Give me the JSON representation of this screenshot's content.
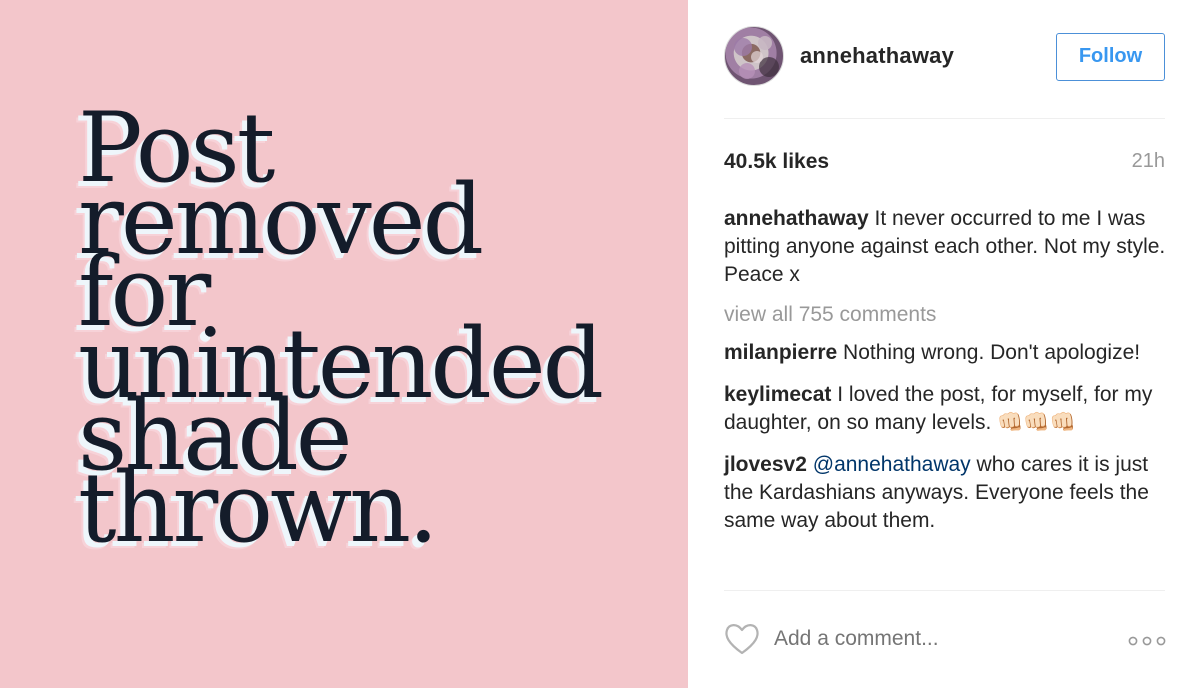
{
  "post_image": {
    "lines": [
      "Post",
      "removed",
      "for",
      "unintended",
      "shade",
      "thrown."
    ],
    "background_color": "#f3c6cb"
  },
  "header": {
    "username": "annehathaway",
    "follow_label": "Follow"
  },
  "stats": {
    "likes": "40.5k likes",
    "time_ago": "21h"
  },
  "caption": {
    "author": "annehathaway",
    "text": " It never occurred to me I was pitting anyone against each other. Not my style. Peace x"
  },
  "view_all_comments": "view all 755 comments",
  "comments": [
    {
      "author": "milanpierre",
      "text": " Nothing wrong. Don't apologize!"
    },
    {
      "author": "keylimecat",
      "text": " I loved the post, for myself, for my daughter, on so many levels. 👊🏻👊🏻👊🏻"
    },
    {
      "author": "jlovesv2",
      "mention": "@annehathaway",
      "text": " who cares it is just the Kardashians anyways. Everyone feels the same way about them."
    }
  ],
  "footer": {
    "comment_placeholder": "Add a comment...",
    "like_icon": "heart-icon",
    "more_icon": "more-options-icon"
  },
  "colors": {
    "accent": "#3897f0",
    "muted": "#999999",
    "mention": "#003569"
  }
}
